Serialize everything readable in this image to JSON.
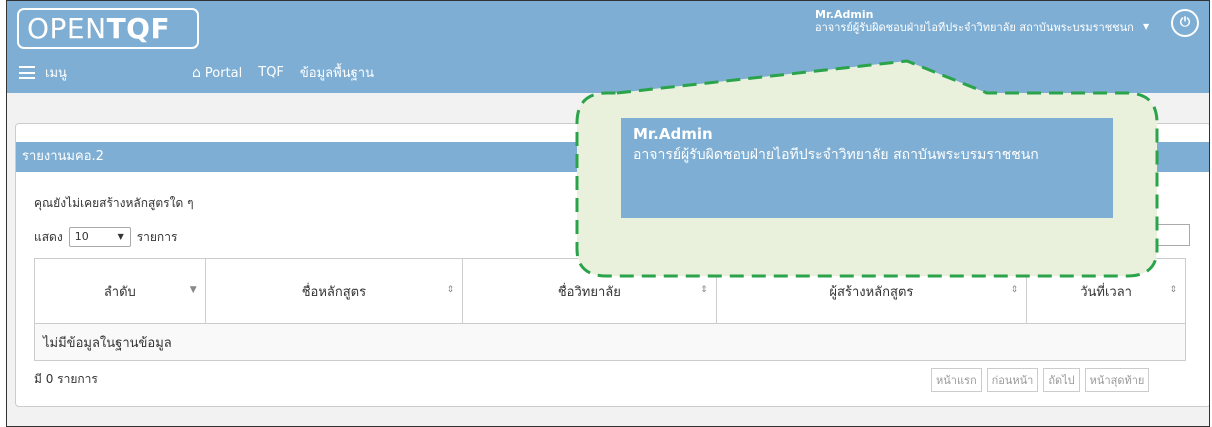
{
  "header": {
    "logo_open": "OPEN",
    "logo_tqf": "TQF",
    "menu_label": "เมนู",
    "nav": {
      "portal": "Portal",
      "tqf": "TQF",
      "basic": "ข้อมูลพื้นฐาน"
    },
    "user_name": "Mr.Admin",
    "user_role": "อาจารย์ผู้รับผิดชอบฝ่ายไอทีประจำวิทยาลัย สถาบันพระบรมราชชนก"
  },
  "panel": {
    "title": "รายงานมคอ.2",
    "notice": "คุณยังไม่เคยสร้างหลักสูตรใด ๆ",
    "length_prefix": "แสดง",
    "length_value": "10",
    "length_suffix": "รายการ",
    "columns": [
      "ลำดับ",
      "ชื่อหลักสูตร",
      "ชื่อวิทยาลัย",
      "ผู้สร้างหลักสูตร",
      "วันที่เวลา"
    ],
    "empty_text": "ไม่มีข้อมูลในฐานข้อมูล",
    "info": "มี 0 รายการ",
    "pager": [
      "หน้าแรก",
      "ก่อนหน้า",
      "ถัดไป",
      "หน้าสุดท้าย"
    ]
  },
  "callout": {
    "name": "Mr.Admin",
    "role": "อาจารย์ผู้รับผิดชอบฝ่ายไอทีประจำวิทยาลัย สถาบันพระบรมราชชนก"
  },
  "colors": {
    "header_bg": "#7eaed3",
    "callout_bg": "#e9f1dd",
    "callout_border": "#2aa34a"
  }
}
